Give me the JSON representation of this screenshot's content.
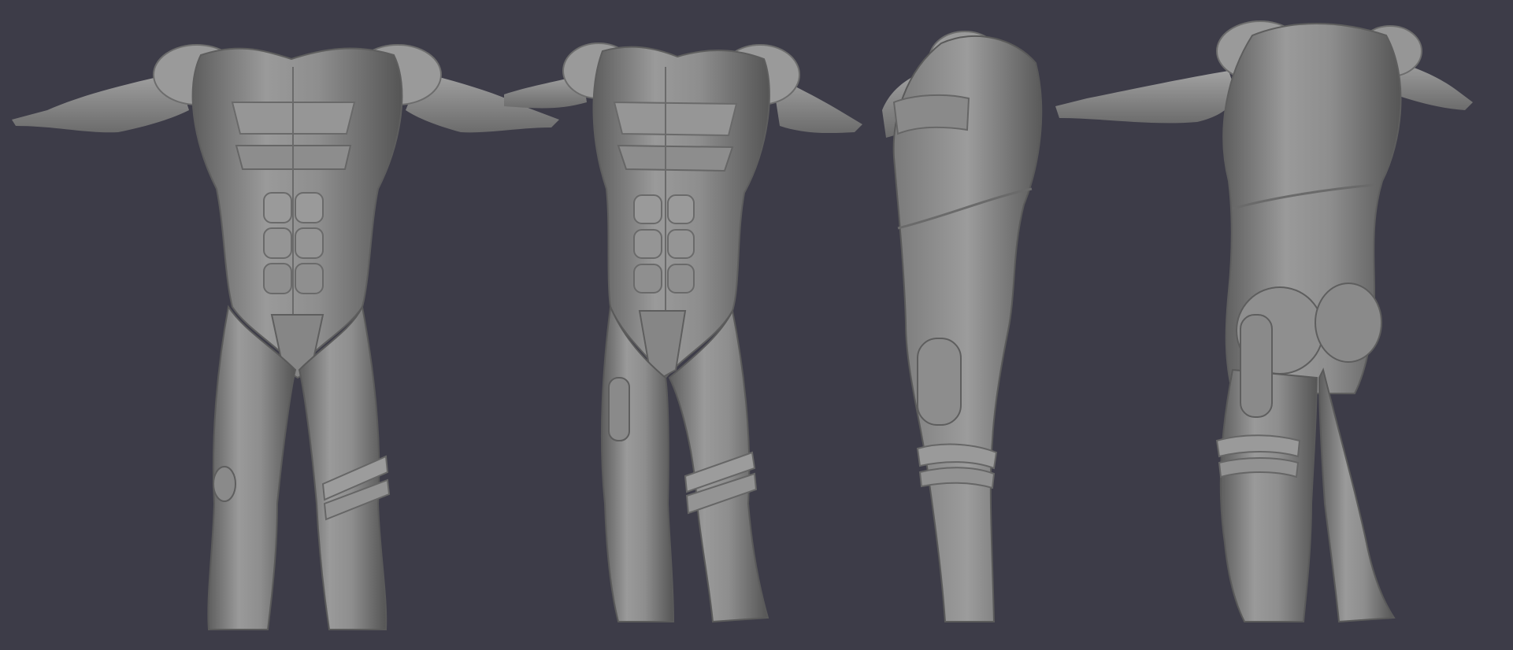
{
  "scene": {
    "background_color": "#3d3c48",
    "suit_color": "#8a8a8a",
    "views": [
      {
        "name": "front-view"
      },
      {
        "name": "three-quarter-front-view"
      },
      {
        "name": "side-view"
      },
      {
        "name": "back-view"
      }
    ]
  }
}
